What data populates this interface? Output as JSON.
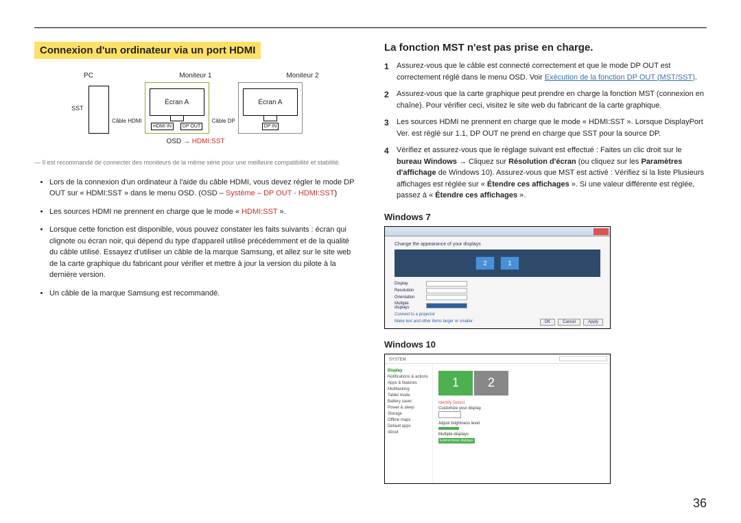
{
  "left": {
    "title": "Connexion d'un ordinateur via un port HDMI",
    "diagram": {
      "pc": "PC",
      "mon1": "Moniteur 1",
      "mon2": "Moniteur 2",
      "sst": "SST",
      "cable_hdmi": "Câble HDMI",
      "cable_dp": "Câble DP",
      "screenA": "Écran A",
      "hdmi_in": "HDMI IN",
      "dp_out": "DP OUT",
      "dp_in": "DP IN",
      "osd_prefix": "OSD → ",
      "osd_red": "HDMI:SST"
    },
    "footnote": "― Il est recommandé de connecter des moniteurs de la même série pour une meilleure compatibilité et stabilité.",
    "bullets": [
      {
        "text_a": "Lors de la connexion d'un ordinateur à l'aide du câble HDMI, vous devez régler le mode DP OUT sur « HDMI:SST » dans le menu OSD. (OSD – ",
        "red": "Système – DP OUT - HDMI:SST",
        "text_b": ")"
      },
      {
        "text_a": "Les sources HDMI ne prennent en charge que le mode « ",
        "red": "HDMI:SST",
        "text_b": " »."
      },
      {
        "text_a": "Lorsque cette fonction est disponible, vous pouvez constater les faits suivants : écran qui clignote ou écran noir, qui dépend du type d'appareil utilisé précédemment et de la qualité du câble utilisé. Essayez d'utiliser un câble de la marque Samsung, et allez sur le site web de la carte graphique du fabricant pour vérifier et mettre à jour la version du pilote à la dernière version.",
        "red": "",
        "text_b": ""
      },
      {
        "text_a": "Un câble de la marque Samsung est recommandé.",
        "red": "",
        "text_b": ""
      }
    ]
  },
  "right": {
    "subtitle": "La fonction MST n'est pas prise en charge.",
    "steps": [
      {
        "num": "1",
        "text_a": "Assurez-vous que le câble est connecté correctement et que le mode DP OUT est correctement réglé dans le menu OSD. Voir ",
        "link": "Exécution de la fonction DP OUT (MST/SST)",
        "text_b": "."
      },
      {
        "num": "2",
        "text_a": "Assurez-vous que la carte graphique peut prendre en charge la fonction MST (connexion en chaîne). Pour vérifier ceci, visitez le site web du fabricant de la carte graphique.",
        "link": "",
        "text_b": ""
      },
      {
        "num": "3",
        "text_a": "Les sources HDMI ne prennent en charge que le mode « HDMI:SST ». Lorsque DisplayPort Ver. est réglé sur 1.1, DP OUT ne prend en charge que SST pour la source DP.",
        "link": "",
        "text_b": ""
      },
      {
        "num": "4",
        "text_a": "Vérifiez et assurez-vous que le réglage suivant est effectué : Faites un clic droit sur le ",
        "bold1": "bureau Windows",
        "text_b": " → Cliquez sur ",
        "bold2": "Résolution d'écran",
        "text_c": " (ou cliquez sur les ",
        "bold3": "Paramètres d'affichage",
        "text_d": " de Windows 10). Assurez-vous que MST est activé : Vérifiez si la liste Plusieurs affichages est réglée sur « ",
        "bold4": "Étendre ces affichages",
        "text_e": " ». Si une valeur différente est réglée, passez à « ",
        "bold5": "Étendre ces affichages",
        "text_f": " »."
      }
    ],
    "win7": {
      "label": "Windows 7",
      "caption": "Change the appearance of your displays",
      "mon1": "2",
      "mon2": "1",
      "display": "Display",
      "resolution": "Resolution",
      "orientation": "Orientation",
      "multi": "Multiple displays",
      "link": "Connect to a projector",
      "link2": "Make text and other items larger or smaller",
      "ok": "OK",
      "cancel": "Cancel",
      "apply": "Apply"
    },
    "win10": {
      "label": "Windows 10",
      "system": "SYSTEM",
      "side": [
        "Display",
        "Notifications & actions",
        "Apps & features",
        "Multitasking",
        "Tablet mode",
        "Battery saver",
        "Power & sleep",
        "Storage",
        "Offline maps",
        "Default apps",
        "About"
      ],
      "mon1": "1",
      "mon2": "2",
      "identify": "Identify  Detect",
      "custom": "Customize your display",
      "bright": "Adjust brightness level",
      "multi": "Multiple displays",
      "extend": "Extend these displays"
    }
  },
  "page_number": "36"
}
